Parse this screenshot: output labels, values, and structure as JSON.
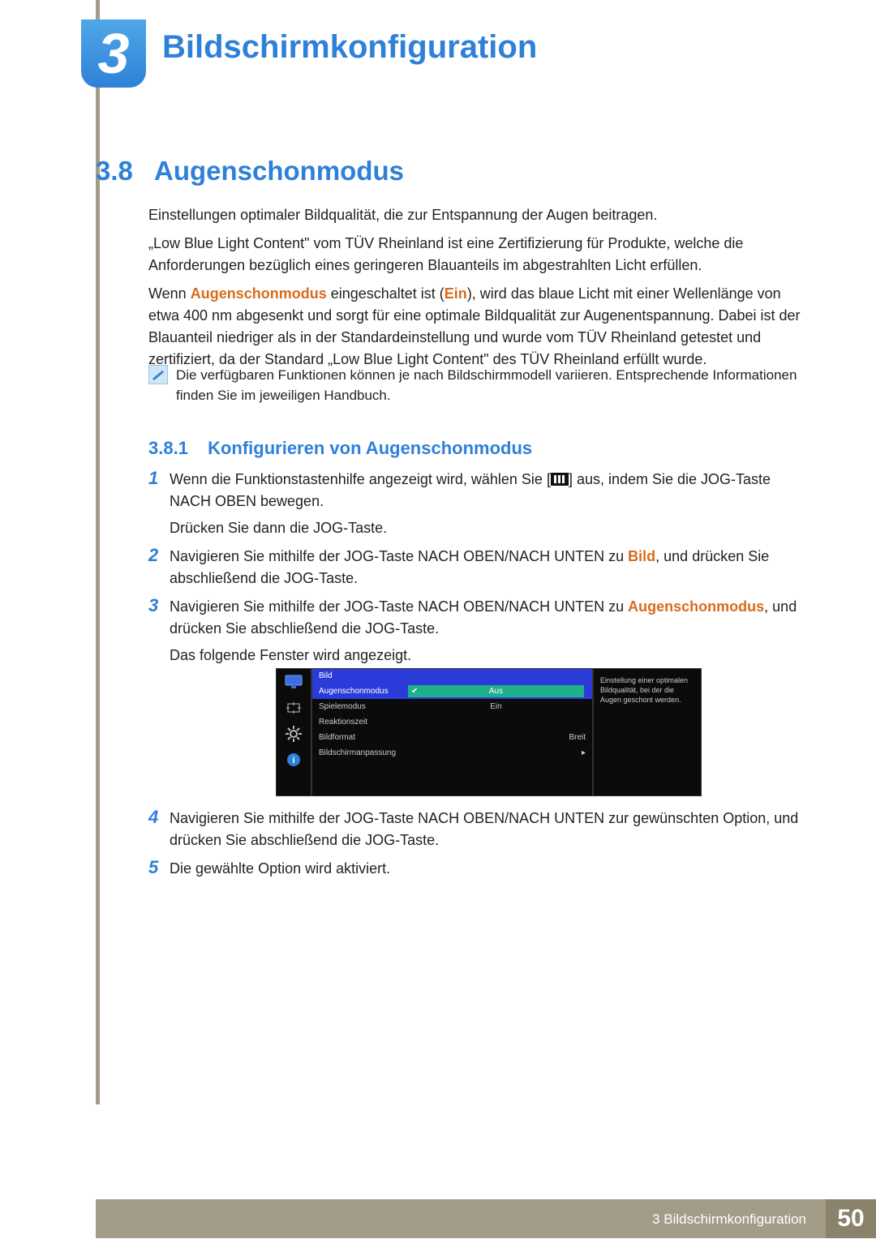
{
  "chapter": {
    "number": "3",
    "title": "Bildschirmkonfiguration"
  },
  "section": {
    "number": "3.8",
    "title": "Augenschonmodus"
  },
  "body": {
    "p1": "Einstellungen optimaler Bildqualität, die zur Entspannung der Augen beitragen.",
    "p2a": "„Low Blue Light Content\" vom TÜV Rheinland ist eine Zertifizierung für Produkte, welche die Anforderungen bezüglich eines geringeren Blauanteils im abgestrahlten Licht erfüllen.",
    "p2b_pre": "Wenn ",
    "p2b_hl1": "Augenschonmodus",
    "p2b_mid1": " eingeschaltet ist (",
    "p2b_hl2": "Ein",
    "p2b_post": "), wird das blaue Licht mit einer Wellenlänge von etwa 400 nm abgesenkt und sorgt für eine optimale Bildqualität zur Augenentspannung. Dabei ist der Blauanteil niedriger als in der Standardeinstellung und wurde vom TÜV Rheinland getestet und zertifiziert, da der Standard „Low Blue Light Content\" des TÜV Rheinland erfüllt wurde."
  },
  "note": "Die verfügbaren Funktionen können je nach Bildschirmmodell variieren. Entsprechende Informationen finden Sie im jeweiligen Handbuch.",
  "subsection": {
    "number": "3.8.1",
    "title": "Konfigurieren von Augenschonmodus"
  },
  "steps": {
    "s1a": "Wenn die Funktionstastenhilfe angezeigt wird, wählen Sie [",
    "s1b": "] aus, indem Sie die JOG-Taste NACH OBEN bewegen.",
    "s1c": "Drücken Sie dann die JOG-Taste.",
    "s2a": "Navigieren Sie mithilfe der JOG-Taste NACH OBEN/NACH UNTEN zu ",
    "s2hl": "Bild",
    "s2b": ", und drücken Sie abschließend die JOG-Taste.",
    "s3a": "Navigieren Sie mithilfe der JOG-Taste NACH OBEN/NACH UNTEN zu ",
    "s3hl": "Augenschonmodus",
    "s3b": ", und drücken Sie abschließend die JOG-Taste.",
    "s3c": "Das folgende Fenster wird angezeigt.",
    "s4": "Navigieren Sie mithilfe der JOG-Taste NACH OBEN/NACH UNTEN zur gewünschten Option, und drücken Sie abschließend die JOG-Taste.",
    "s5": "Die gewählte Option wird aktiviert."
  },
  "step_nums": {
    "n1": "1",
    "n2": "2",
    "n3": "3",
    "n4": "4",
    "n5": "5"
  },
  "osd": {
    "header": "Bild",
    "rows": [
      {
        "label": "Augenschonmodus",
        "value": "Aus",
        "selected": true
      },
      {
        "label": "Spielemodus",
        "value": "Ein",
        "selected": false
      },
      {
        "label": "Reaktionszeit",
        "value": "",
        "selected": false
      },
      {
        "label": "Bildformat",
        "value": "Breit",
        "selected": false,
        "align": "right"
      },
      {
        "label": "Bildschirmanpassung",
        "value": "▸",
        "selected": false,
        "align": "right"
      }
    ],
    "hint": "Einstellung einer optimalen Bildqualität, bei der die Augen geschont werden."
  },
  "footer": {
    "label": "3 Bildschirmkonfiguration",
    "page": "50"
  }
}
